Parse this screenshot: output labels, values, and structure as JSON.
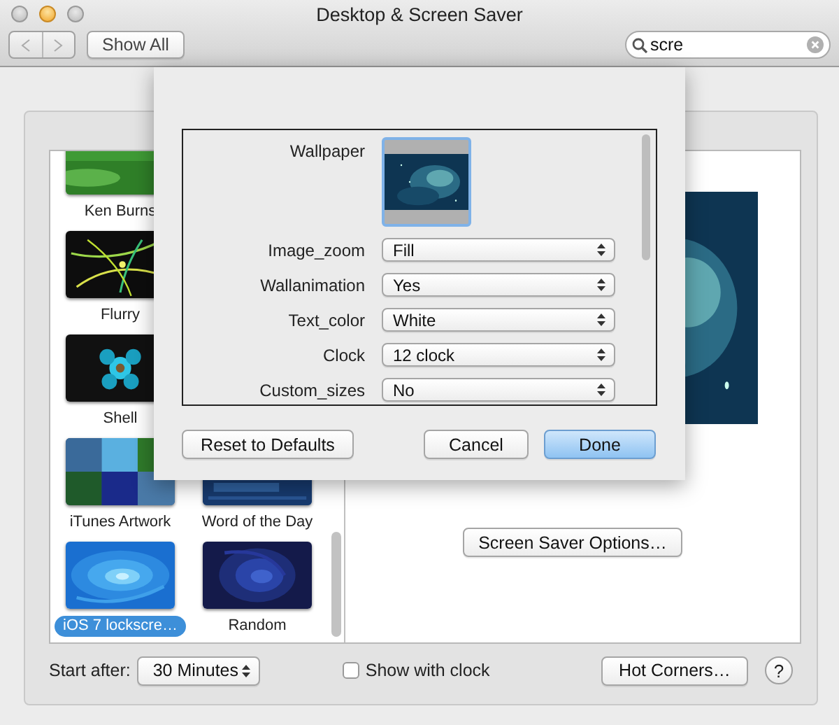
{
  "window": {
    "title": "Desktop & Screen Saver"
  },
  "toolbar": {
    "show_all": "Show All",
    "search": {
      "value": "scre"
    }
  },
  "screen_savers": [
    {
      "label": "Ken Burns",
      "selected": false
    },
    {
      "label": "Flurry",
      "selected": false
    },
    {
      "label": "Shell",
      "selected": false
    },
    {
      "label": "iTunes Artwork",
      "selected": false
    },
    {
      "label": "Word of the Day",
      "selected": false
    },
    {
      "label": "iOS 7 lockscre…",
      "selected": true
    },
    {
      "label": "Random",
      "selected": false
    }
  ],
  "preview": {
    "options_button": "Screen Saver Options…"
  },
  "bottom": {
    "start_after_label": "Start after:",
    "start_after_value": "30 Minutes",
    "show_with_clock": {
      "label": "Show with clock",
      "checked": false
    },
    "hot_corners": "Hot Corners…",
    "help": "?"
  },
  "sheet": {
    "wallpaper_label": "Wallpaper",
    "settings": [
      {
        "label": "Image_zoom",
        "value": "Fill"
      },
      {
        "label": "Wallanimation",
        "value": "Yes"
      },
      {
        "label": "Text_color",
        "value": "White"
      },
      {
        "label": "Clock",
        "value": "12 clock"
      },
      {
        "label": "Custom_sizes",
        "value": "No"
      }
    ],
    "buttons": [
      {
        "label": "Reset to Defaults",
        "default": false
      },
      {
        "label": "Cancel",
        "default": false
      },
      {
        "label": "Done",
        "default": true
      }
    ]
  }
}
